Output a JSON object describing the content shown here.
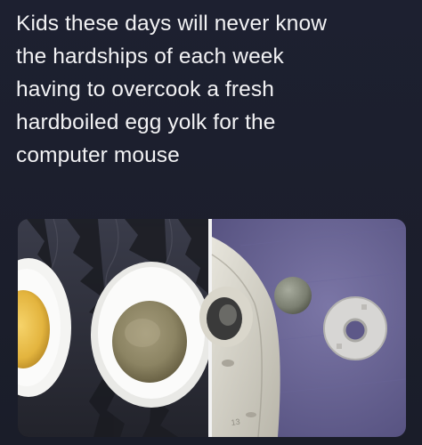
{
  "post": {
    "caption_lines": [
      "Kids these days will never know",
      "the hardships of each week",
      "having to overcook a fresh",
      "hardboiled egg yolk for the",
      "computer mouse"
    ]
  },
  "photo_left": {
    "content": "two halved hardboiled eggs on dark patterned cloth, one yolk yellow, one overcooked grey"
  },
  "photo_right": {
    "content": "underside of an old ball mouse opened, with grey rubber ball and retaining ring on purple mousepad",
    "embossed_text": "13"
  }
}
